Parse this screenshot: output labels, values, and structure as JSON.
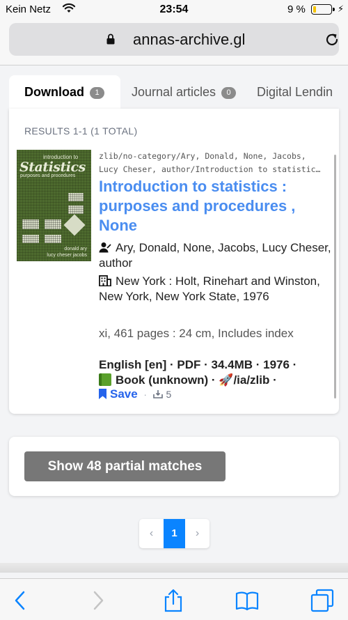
{
  "status_bar": {
    "carrier": "Kein Netz",
    "time": "23:54",
    "battery_percent": "9 %",
    "battery_level": 0.09
  },
  "address_bar": {
    "url": "annas-archive.gl"
  },
  "tabs": [
    {
      "label": "Download",
      "count": "1",
      "active": true
    },
    {
      "label": "Journal articles",
      "count": "0",
      "active": false
    },
    {
      "label": "Digital Lendin",
      "active": false
    }
  ],
  "results": {
    "summary": "RESULTS 1-1 (1 TOTAL)",
    "items": [
      {
        "cover": {
          "top_text": "introduction to",
          "title_text": "Statistics",
          "subtitle_text": "purposes and procedures",
          "author_text_1": "donald ary",
          "author_text_2": "lucy cheser jacobs"
        },
        "path_line_1": "zlib/no-category/Ary, Donald, None, Jacobs,",
        "path_line_2": "Lucy Cheser, author/Introduction to statistic…",
        "title": "Introduction to statistics : purposes and procedures , None",
        "author": "Ary, Donald, None, Jacobs, Lucy Cheser, author",
        "publisher": "New York : Holt, Rinehart and Winston, New York, New York State, 1976",
        "description": "xi, 461 pages : 24 cm, Includes index",
        "meta_line_1": "English [en] · PDF · 34.4MB · 1976 ·",
        "meta_book": "Book (unknown) ·",
        "meta_rocket": "🚀",
        "meta_source": "/ia/zlib ·",
        "save_label": "Save",
        "separator": "·",
        "downloads": "5"
      }
    ]
  },
  "partial_matches": {
    "button_label": "Show 48 partial matches"
  },
  "pagination": {
    "prev": "‹",
    "current": "1",
    "next": "›"
  },
  "icons": {
    "lock": "lock-icon",
    "reload": "reload-icon",
    "author": "user-icon",
    "publisher": "building-icon",
    "book": "green-book-icon",
    "bookmark": "bookmark-icon",
    "download": "download-tray-icon",
    "back": "back-icon",
    "forward": "forward-icon",
    "share": "share-icon",
    "bookmarks": "book-open-icon",
    "tabs": "tabs-icon"
  },
  "colors": {
    "link_title": "#4a8df0",
    "save": "#2563eb",
    "pager_active": "#0a84ff",
    "toolbar_icon": "#0a84ff",
    "battery_fill": "#f5c400",
    "partial_button": "#777777"
  }
}
